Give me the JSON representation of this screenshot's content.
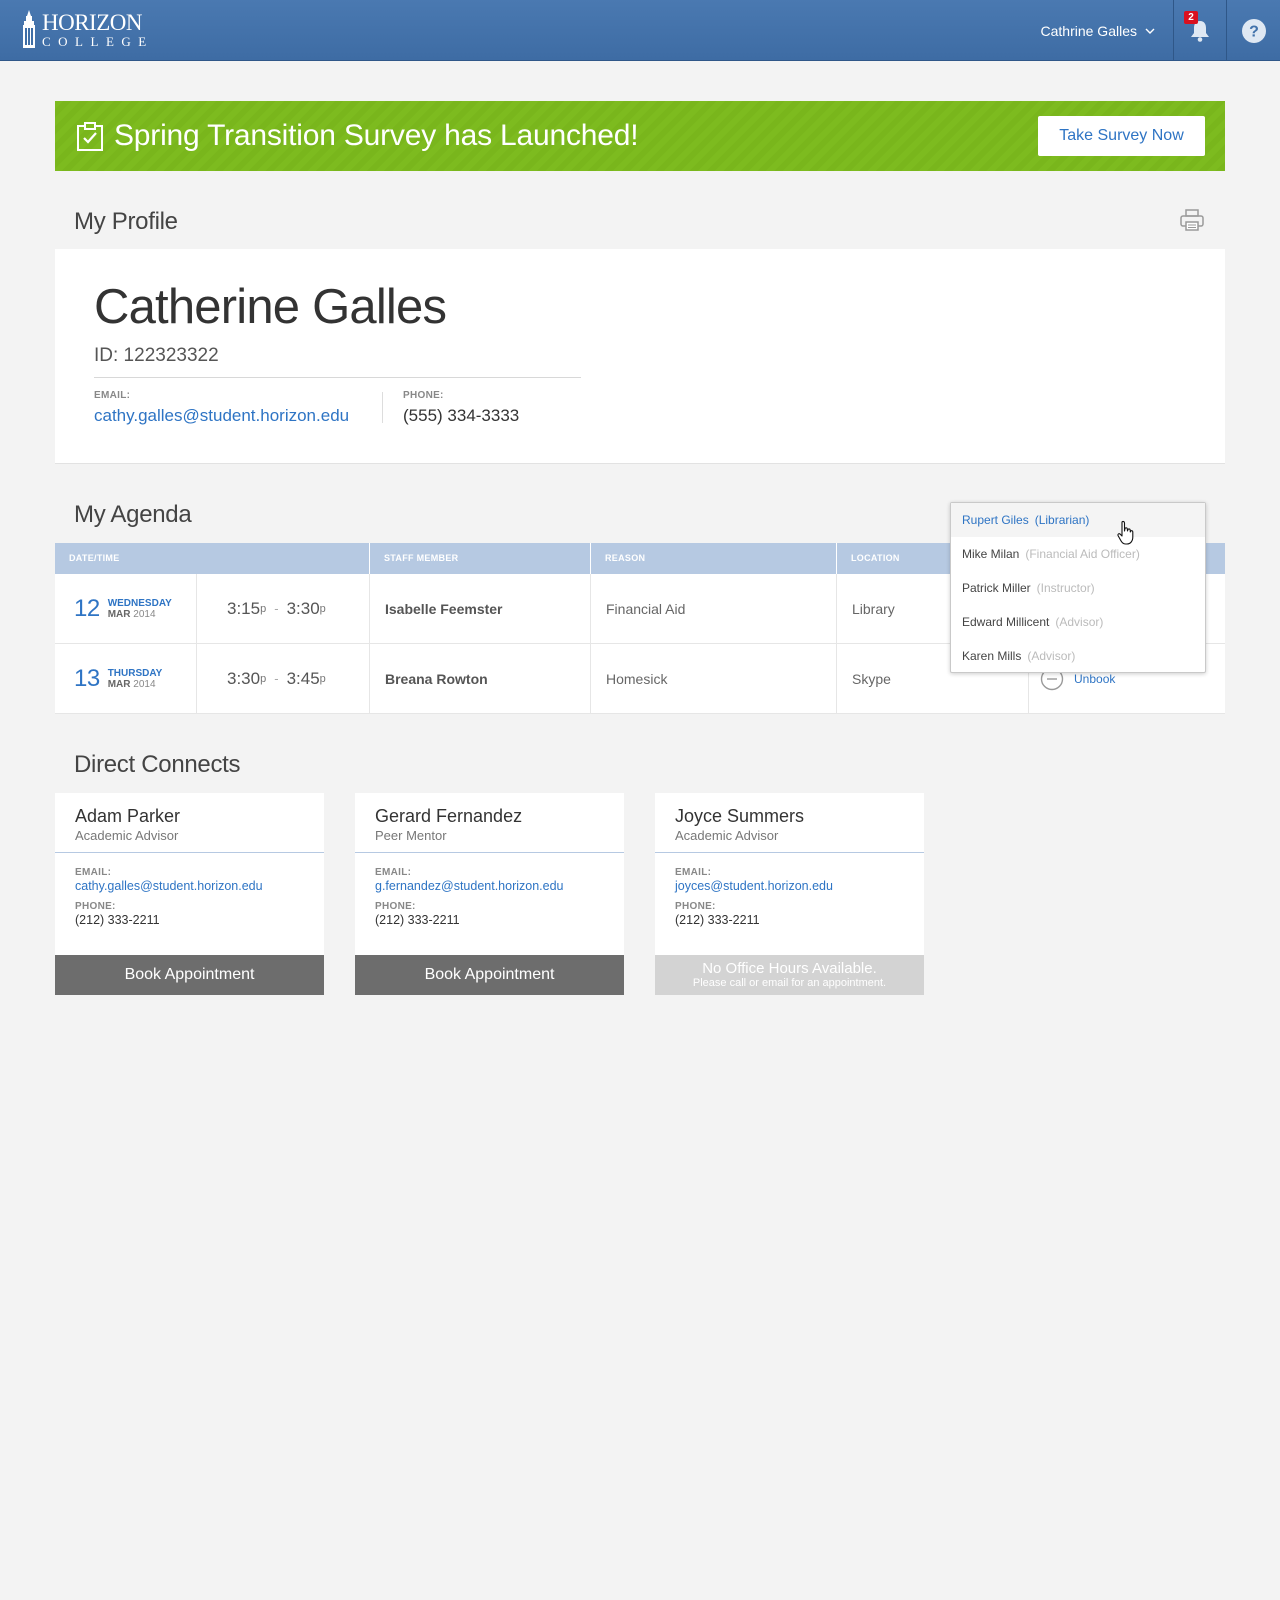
{
  "header": {
    "logo_top": "HORIZON",
    "logo_bottom": "COLLEGE",
    "user_name": "Cathrine Galles",
    "notification_count": "2"
  },
  "banner": {
    "text": "Spring Transition Survey has Launched!",
    "button_label": "Take Survey Now"
  },
  "profile": {
    "section_title": "My Profile",
    "name": "Catherine Galles",
    "id_text": "ID: 122323322",
    "email_label": "EMAIL:",
    "email": "cathy.galles@student.horizon.edu",
    "phone_label": "PHONE:",
    "phone": "(555) 334-3333"
  },
  "agenda": {
    "section_title": "My Agenda",
    "columns": [
      "DATE/TIME",
      "STAFF MEMBER",
      "REASON",
      "LOCATION"
    ],
    "rows": [
      {
        "day": "12",
        "weekday": "WEDNESDAY",
        "month": "MAR",
        "year": "2014",
        "start": "3:15",
        "start_suffix": "p",
        "end": "3:30",
        "end_suffix": "p",
        "separator": "-",
        "staff": "Isabelle Feemster",
        "reason": "Financial Aid",
        "location": "Library"
      },
      {
        "day": "13",
        "weekday": "THURSDAY",
        "month": "MAR",
        "year": "2014",
        "start": "3:30",
        "start_suffix": "p",
        "end": "3:45",
        "end_suffix": "p",
        "separator": "-",
        "staff": "Breana Rowton",
        "reason": "Homesick",
        "location": "Skype",
        "action": "Unbook"
      }
    ]
  },
  "staff_dropdown": {
    "items": [
      {
        "name": "Rupert Giles",
        "role": "(Librarian)",
        "active": true
      },
      {
        "name": "Mike Milan",
        "role": "(Financial Aid Officer)"
      },
      {
        "name": "Patrick Miller",
        "role": "(Instructor)"
      },
      {
        "name": "Edward Millicent",
        "role": "(Advisor)"
      },
      {
        "name": "Karen Mills",
        "role": "(Advisor)"
      }
    ]
  },
  "connects": {
    "section_title": "Direct Connects",
    "email_label": "EMAIL:",
    "phone_label": "PHONE:",
    "cards": [
      {
        "name": "Adam Parker",
        "role": "Academic Advisor",
        "email": "cathy.galles@student.horizon.edu",
        "phone": "(212) 333-2211",
        "button": "Book Appointment"
      },
      {
        "name": "Gerard Fernandez",
        "role": "Peer Mentor",
        "email": "g.fernandez@student.horizon.edu",
        "phone": "(212) 333-2211",
        "button": "Book Appointment"
      },
      {
        "name": "Joyce Summers",
        "role": "Academic Advisor",
        "email": "joyces@student.horizon.edu",
        "phone": "(212) 333-2211",
        "no_hours_title": "No Office Hours Available.",
        "no_hours_sub": "Please call or email for an appointment."
      }
    ]
  },
  "colors": {
    "header_blue": "#4272ab",
    "banner_green": "#7dbb1f",
    "link_blue": "#2e74c4",
    "table_head": "#b6c9e2",
    "badge_red": "#d9101f"
  }
}
